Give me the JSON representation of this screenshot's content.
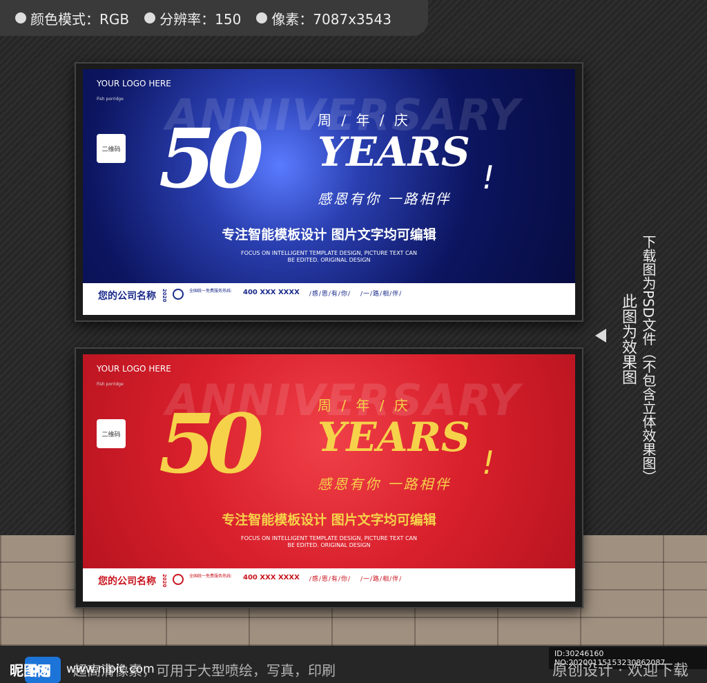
{
  "topbar": {
    "items": [
      "颜色模式：RGB",
      "分辨率：150",
      "像素：7087x3543"
    ]
  },
  "board": {
    "logo": "YOUR LOGO HERE",
    "small_text": "Fish porridge",
    "qr": "二维码",
    "anniversary": "ANNIVERSARY",
    "zn_title": "周 / 年 / 庆",
    "fifty": "50",
    "years": "YEARS",
    "excl": "!",
    "thanks": "感恩有你 一路相伴",
    "slogan": "专注智能模板设计 图片文字均可编辑",
    "en_line1": "FOCUS ON INTELLIGENT TEMPLATE DESIGN, PICTURE TEXT CAN",
    "en_line2": "BE EDITED. ORIGINAL DESIGN",
    "company": "您的公司名称",
    "year": "2020",
    "hotline": "全国统一免费服务热线:",
    "phone": "400 XXX XXXX",
    "words1": "/感/恩/有/你/",
    "words2": "/一/路/相/伴/"
  },
  "side": {
    "note": "下载图为PSD文件（不包含立体效果图）",
    "effect": "此图为效果图"
  },
  "bottom": {
    "brand": "昵图网",
    "ps": "PS",
    "url": "www.nipic.com",
    "features": "超高清像素，可用于大型喷绘，写真，印刷",
    "id": "ID:30246160 NO:20200115153230862087",
    "original": "原创设计 · 欢迎下载"
  }
}
